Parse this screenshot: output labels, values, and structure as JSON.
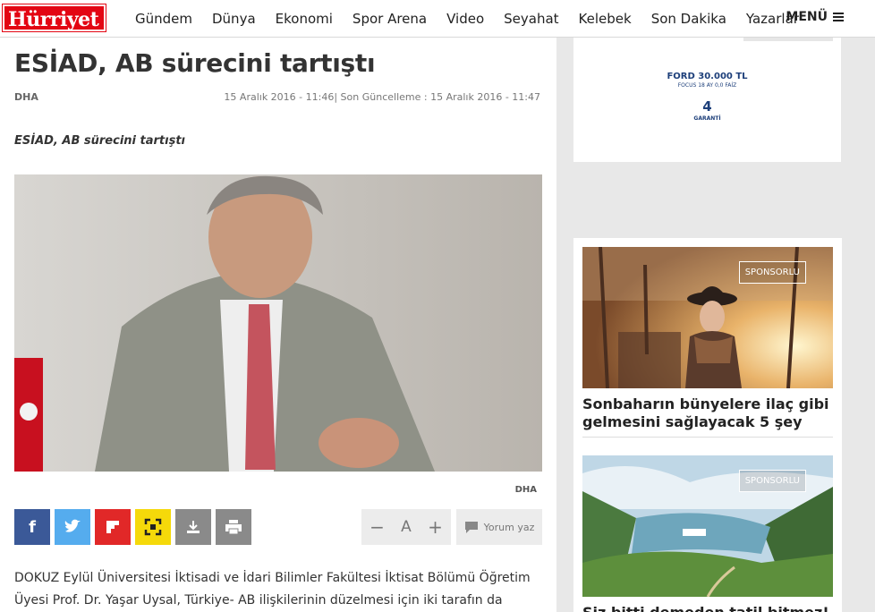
{
  "header": {
    "logo_text": "Hürriyet",
    "nav": [
      "Gündem",
      "Dünya",
      "Ekonomi",
      "Spor Arena",
      "Video",
      "Seyahat",
      "Kelebek",
      "Son Dakika",
      "Yazarlar"
    ],
    "menu_label": "MENÜ"
  },
  "article": {
    "title": "ESİAD, AB sürecini tartıştı",
    "source": "DHA",
    "published": "15 Aralık 2016 - 11:46",
    "updated": "Son Güncelleme : 15 Aralık 2016 - 11:47",
    "spot": "ESİAD, AB sürecini tartıştı",
    "photo_credit": "DHA",
    "body": "DOKUZ Eylül Üniversitesi İktisadi ve İdari Bilimler Fakültesi İktisat Bölümü Öğretim Üyesi Prof. Dr. Yaşar Uysal, Türkiye- AB ilişkilerinin düzelmesi için iki tarafın da samimi"
  },
  "toolbar": {
    "font_minus": "−",
    "font_label": "A",
    "font_plus": "+",
    "comment_label": "Yorum yaz"
  },
  "ad": {
    "brand_line": "FORD 30.000 TL",
    "model_line": "FOCUS 18 AY 0,0 FAİZ",
    "warranty_number": "4",
    "warranty_label": "GARANTİ"
  },
  "sidebar": {
    "cards": [
      {
        "badge": "SPONSORLU",
        "title": "Sonbaharın bünyelere ilaç gibi gelmesini sağlayacak 5 şey"
      },
      {
        "badge": "SPONSORLU",
        "title": "Siz bitti demeden tatil bitmez! İşte"
      }
    ]
  },
  "colors": {
    "brand_red": "#e30613",
    "facebook": "#3b5998",
    "twitter": "#55acee",
    "flipboard": "#e12828",
    "yellow_share": "#f5d90a",
    "gray_btn": "#8a8a8a"
  }
}
